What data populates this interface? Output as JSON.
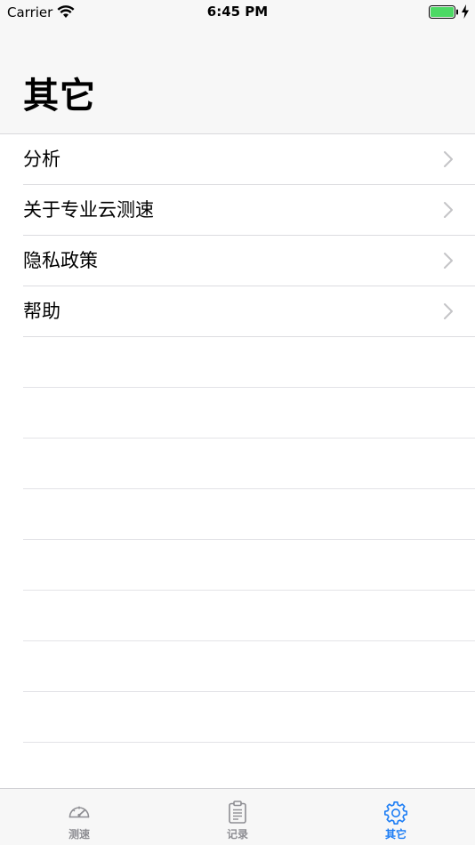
{
  "status_bar": {
    "carrier": "Carrier",
    "time": "6:45 PM",
    "battery_color": "#4cd964"
  },
  "header": {
    "title": "其它"
  },
  "menu": {
    "items": [
      {
        "label": "分析",
        "icon": "chevron-right-icon"
      },
      {
        "label": "关于专业云测速",
        "icon": "chevron-right-icon"
      },
      {
        "label": "隐私政策",
        "icon": "chevron-right-icon"
      },
      {
        "label": "帮助",
        "icon": "chevron-right-icon"
      }
    ]
  },
  "tab_bar": {
    "active_color": "#1a7cf5",
    "inactive_color": "#8e8e93",
    "tabs": [
      {
        "label": "测速",
        "icon": "speedometer-icon",
        "active": false
      },
      {
        "label": "记录",
        "icon": "clipboard-icon",
        "active": false
      },
      {
        "label": "其它",
        "icon": "gear-icon",
        "active": true
      }
    ]
  }
}
